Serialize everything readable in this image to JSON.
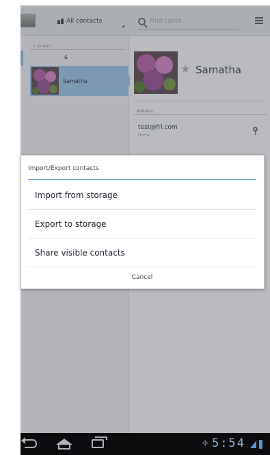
{
  "topbar": {
    "group_label": "All contacts",
    "search_placeholder": "Find conta..."
  },
  "list": {
    "count_label": "1 contact",
    "section_letter": "S",
    "contacts": [
      {
        "name": "Samatha"
      }
    ]
  },
  "detail": {
    "name": "Samatha",
    "section_label": "Address",
    "email_value": "test@fri.com",
    "email_type": "Home"
  },
  "dialog": {
    "title": "Import/Export contacts",
    "options": [
      {
        "label": "Import from storage"
      },
      {
        "label": "Export to storage"
      },
      {
        "label": "Share visible contacts"
      }
    ],
    "cancel_label": "Cancel"
  },
  "statusbar": {
    "time": "5:54"
  },
  "colors": {
    "accent": "#7fb0dc",
    "selection": "#8fb2d3",
    "clock": "#8fb2d8"
  }
}
